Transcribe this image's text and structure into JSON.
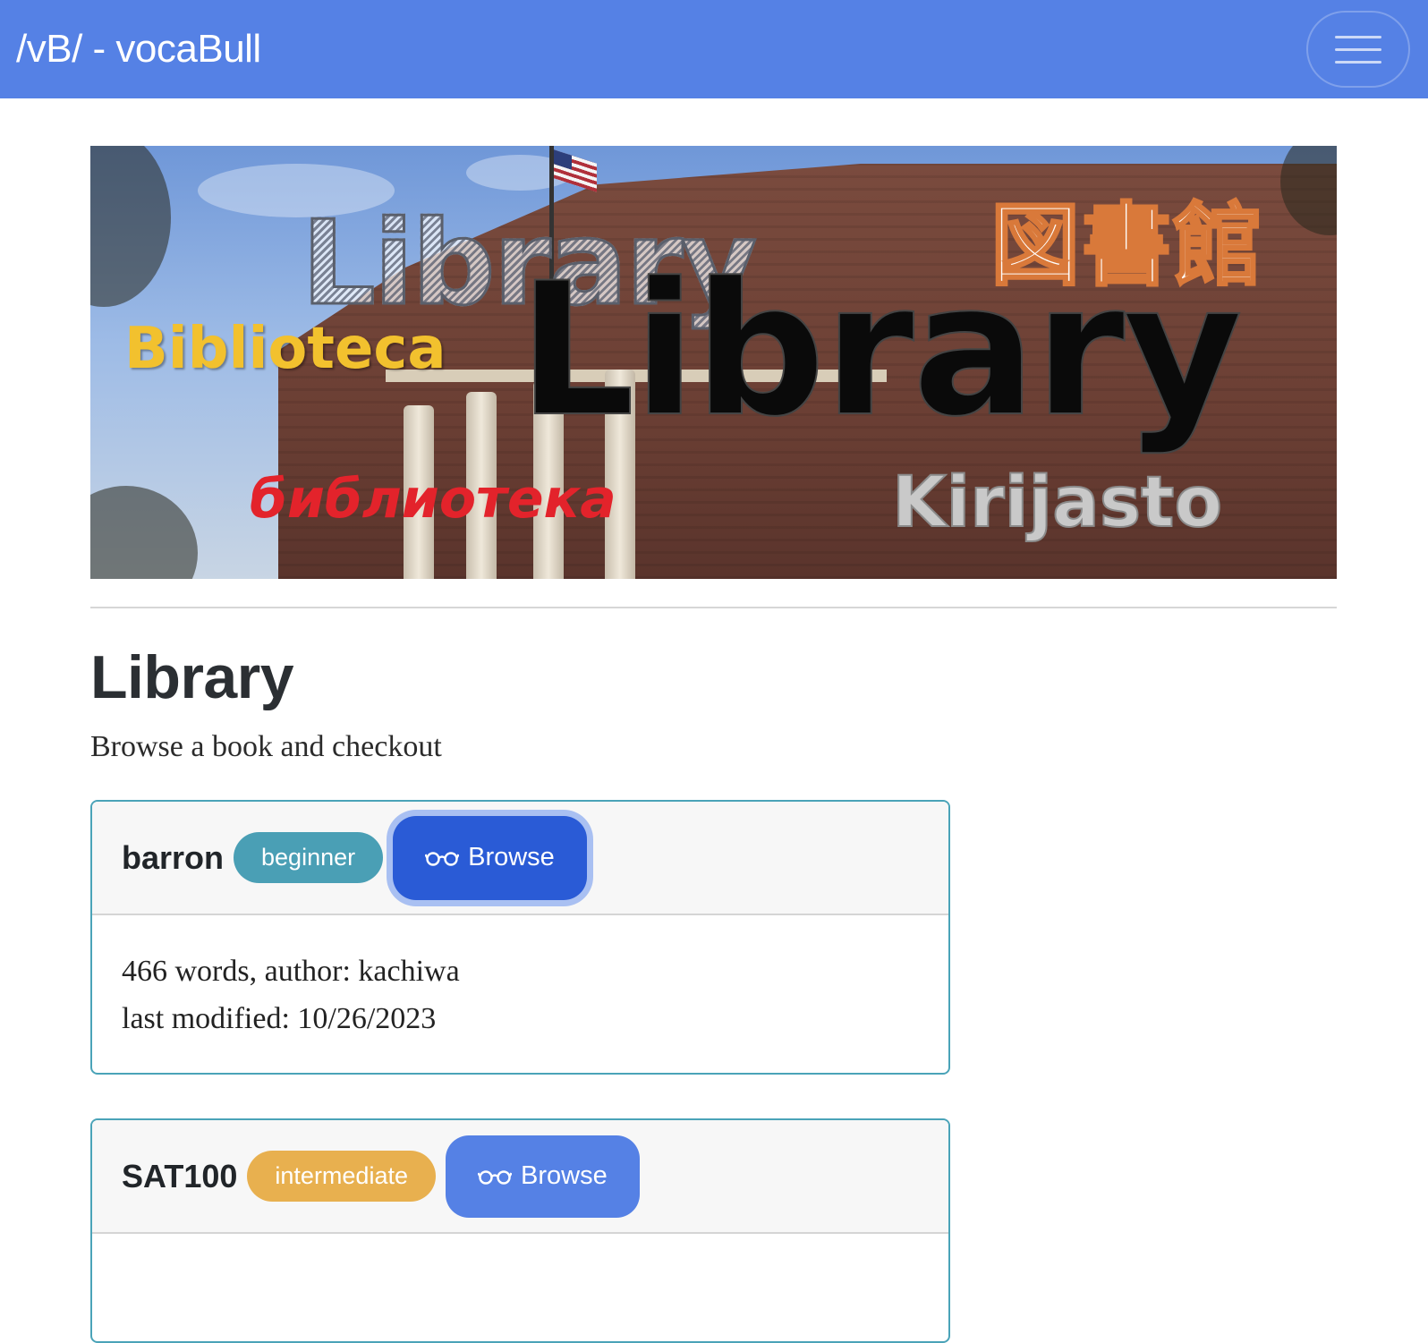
{
  "navbar": {
    "brand": "/vB/ - vocaBull",
    "menu_icon": "hamburger-icon"
  },
  "banner": {
    "texts": {
      "library_large": "Library",
      "library_outline": "Library",
      "spanish": "Biblioteca",
      "russian": "библиотека",
      "finnish": "Kirijasto",
      "japanese": "図書館"
    }
  },
  "page": {
    "title": "Library",
    "subtitle": "Browse a book and checkout"
  },
  "books": [
    {
      "name": "barron",
      "level": "beginner",
      "level_color": "#4a9fb5",
      "browse_label": "Browse",
      "browse_icon": "glasses-icon",
      "details_line1": "466 words, author: kachiwa",
      "details_line2": "last modified: 10/26/2023"
    },
    {
      "name": "SAT100",
      "level": "intermediate",
      "level_color": "#e8b04f",
      "browse_label": "Browse",
      "browse_icon": "glasses-icon"
    }
  ],
  "colors": {
    "navbar": "#5581e5",
    "card_border": "#4aa3b8",
    "button": "#5581e5",
    "button_focused": "#2a5bd6"
  }
}
